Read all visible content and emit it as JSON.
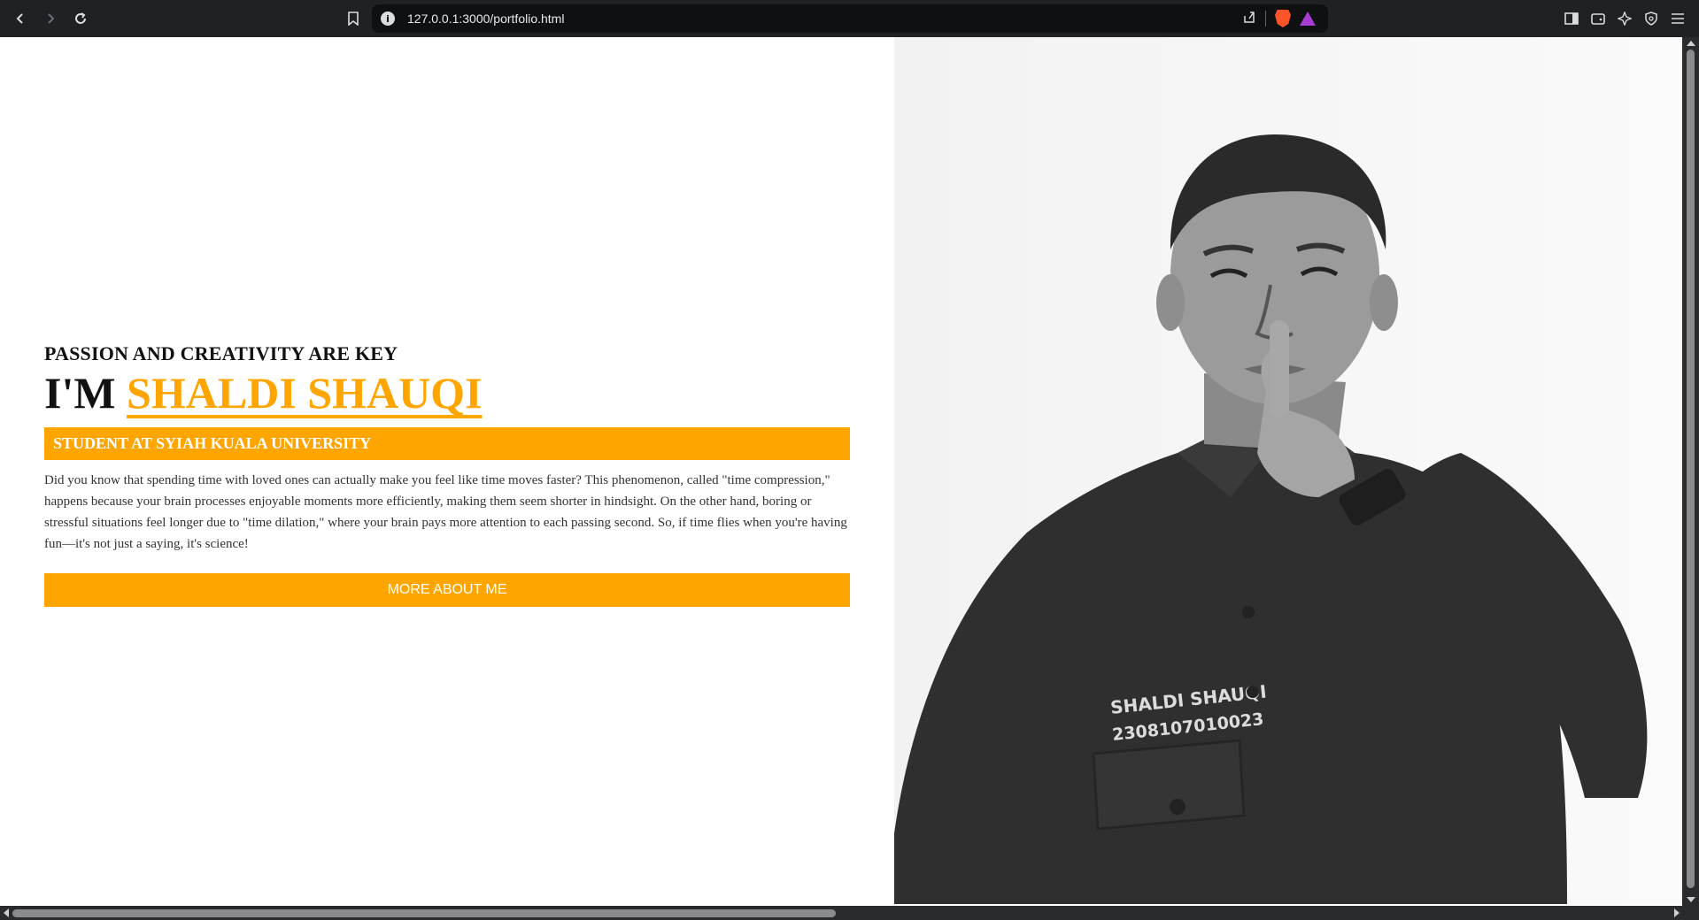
{
  "browser": {
    "url": "127.0.0.1:3000/portfolio.html",
    "icons": [
      "back-icon",
      "forward-icon",
      "reload-icon",
      "bookmark-icon",
      "site-info-icon",
      "share-icon",
      "brave-shields-icon",
      "brave-rewards-icon",
      "sidebar-icon",
      "wallet-icon",
      "leo-ai-icon",
      "vpn-icon",
      "menu-icon"
    ]
  },
  "hero": {
    "tagline": "PASSION AND CREATIVITY ARE KEY",
    "greeting": "I'M",
    "name": "SHALDI SHAUQI",
    "role": "STUDENT AT SYIAH KUALA UNIVERSITY",
    "bio": "Did you know that spending time with loved ones can actually make you feel like time moves faster? This phenomenon, called \"time compression,\" happens because your brain processes enjoyable moments more efficiently, making them seem shorter in hindsight. On the other hand, boring or stressful situations feel longer due to \"time dilation,\" where your brain pays more attention to each passing second. So, if time flies when you're having fun—it's not just a saying, it's science!",
    "cta_label": "MORE ABOUT ME"
  },
  "photo": {
    "badge_name": "SHALDI SHAUQI",
    "badge_id": "2308107010023"
  },
  "colors": {
    "accent": "#ffa500",
    "chrome": "#202124",
    "text": "#111111"
  }
}
